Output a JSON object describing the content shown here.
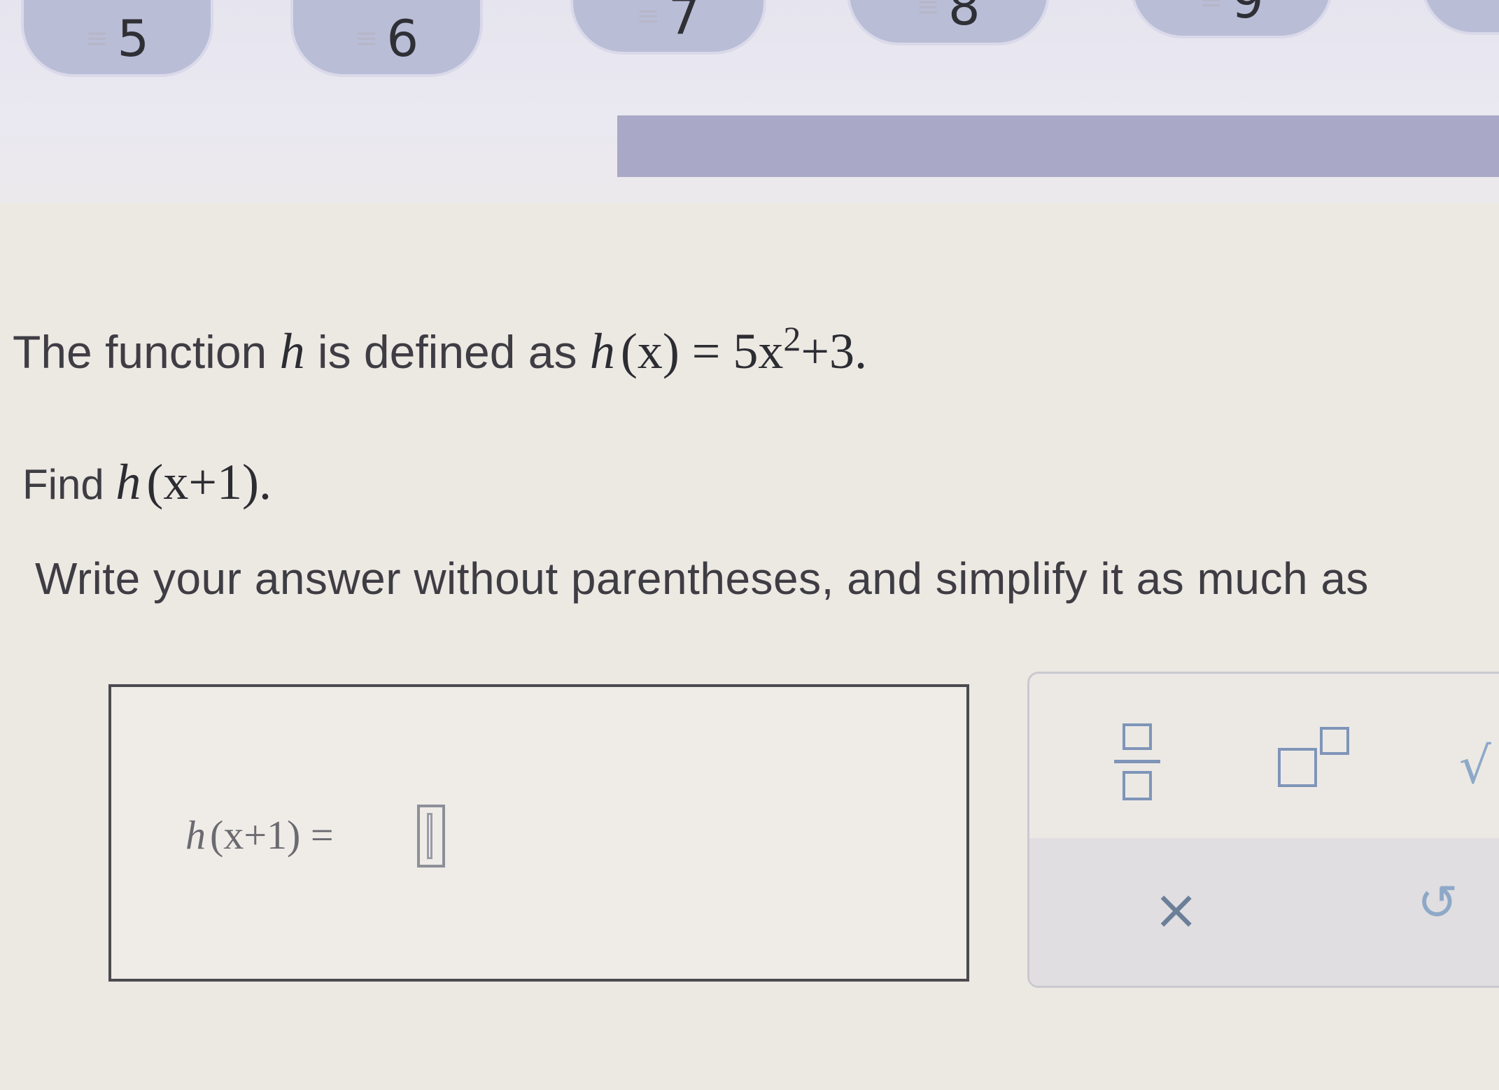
{
  "question_nav": {
    "items": [
      {
        "number": "5"
      },
      {
        "number": "6"
      },
      {
        "number": "7"
      },
      {
        "number": "8"
      },
      {
        "number": "9"
      }
    ],
    "marker": "≡"
  },
  "problem": {
    "intro_prefix": "The function",
    "intro_var": "h",
    "intro_middle": "is defined as",
    "definition_lhs_h": "h",
    "definition_lhs_arg": "(x)",
    "definition_eq": "=",
    "definition_coef": "5x",
    "definition_exp": "2",
    "definition_rest": "+3.",
    "find_label": "Find",
    "find_h": "h",
    "find_arg": "(x+1).",
    "instruction": "Write your answer without parentheses, and simplify it as much as"
  },
  "answer": {
    "label_h": "h",
    "label_rest": "(x+1) =",
    "value": ""
  },
  "tools": {
    "times_symbol": "×",
    "undo_symbol": "↺",
    "sqrt_symbol": "√"
  }
}
